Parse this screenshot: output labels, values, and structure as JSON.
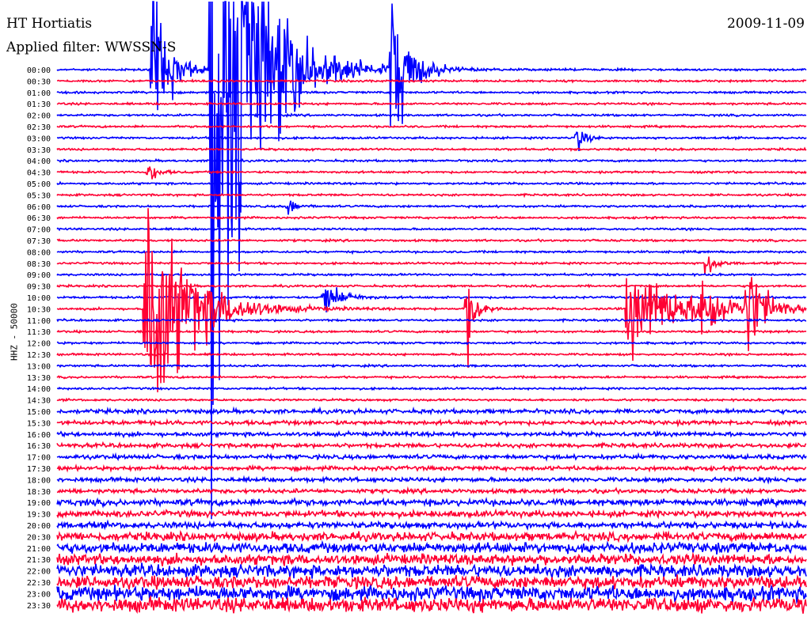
{
  "header": {
    "station": "HT Hortiatis",
    "date": "2009-11-09",
    "filter": "Applied filter: WWSSN-S"
  },
  "channel_label": "HHZ - 50000",
  "colors": {
    "even": "#0000ff",
    "odd": "#ff0033"
  },
  "chart_data": {
    "type": "line",
    "title": "HT Hortiatis",
    "subtitle": "Applied filter: WWSSN-S",
    "ylabel": "HHZ - 50000",
    "row_interval_minutes": 30,
    "categories": [
      "00:00",
      "00:30",
      "01:00",
      "01:30",
      "02:00",
      "02:30",
      "03:00",
      "03:30",
      "04:00",
      "04:30",
      "05:00",
      "05:30",
      "06:00",
      "06:30",
      "07:00",
      "07:30",
      "08:00",
      "08:30",
      "09:00",
      "09:30",
      "10:00",
      "10:30",
      "11:00",
      "11:30",
      "12:00",
      "12:30",
      "13:00",
      "13:30",
      "14:00",
      "14:30",
      "15:00",
      "15:30",
      "16:00",
      "16:30",
      "17:00",
      "17:30",
      "18:00",
      "18:30",
      "19:00",
      "19:30",
      "20:00",
      "20:30",
      "21:00",
      "21:30",
      "22:00",
      "22:30",
      "23:00",
      "23:30"
    ],
    "noise_level": [
      1,
      1,
      1,
      1,
      1,
      1,
      1,
      1,
      1,
      1,
      1,
      1,
      1,
      1,
      1,
      1,
      1,
      1,
      1,
      1,
      1,
      1,
      1,
      1,
      1,
      1,
      1,
      1,
      1,
      1,
      2,
      2,
      2,
      2,
      2,
      2,
      2,
      2,
      3,
      3,
      3,
      4,
      5,
      5,
      6,
      6,
      7,
      7
    ],
    "events": [
      {
        "row": 0,
        "x": 0.127,
        "amplitude": 90,
        "decay": 0.02
      },
      {
        "row": 0,
        "x": 0.205,
        "amplitude": 400,
        "decay": 0.05
      },
      {
        "row": 0,
        "x": 0.445,
        "amplitude": 100,
        "decay": 0.02
      },
      {
        "row": 6,
        "x": 0.694,
        "amplitude": 15,
        "decay": 0.01
      },
      {
        "row": 9,
        "x": 0.122,
        "amplitude": 12,
        "decay": 0.01
      },
      {
        "row": 12,
        "x": 0.308,
        "amplitude": 10,
        "decay": 0.01
      },
      {
        "row": 17,
        "x": 0.867,
        "amplitude": 18,
        "decay": 0.01
      },
      {
        "row": 20,
        "x": 0.356,
        "amplitude": 20,
        "decay": 0.02
      },
      {
        "row": 21,
        "x": 0.118,
        "amplitude": 140,
        "decay": 0.05
      },
      {
        "row": 21,
        "x": 0.547,
        "amplitude": 60,
        "decay": 0.01
      },
      {
        "row": 21,
        "x": 0.76,
        "amplitude": 50,
        "decay": 0.06
      },
      {
        "row": 21,
        "x": 0.86,
        "amplitude": 40,
        "decay": 0.02
      },
      {
        "row": 21,
        "x": 0.92,
        "amplitude": 55,
        "decay": 0.02
      }
    ]
  }
}
